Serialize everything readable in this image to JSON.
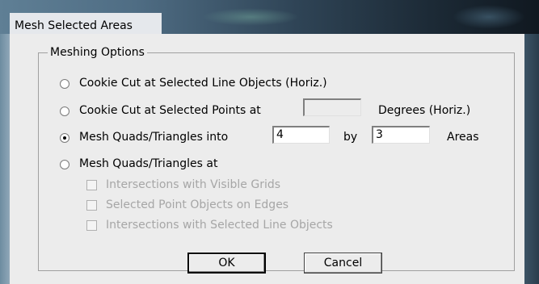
{
  "window": {
    "title": "Mesh Selected Areas"
  },
  "group": {
    "label": "Meshing Options"
  },
  "options": {
    "cookie_line": "Cookie Cut at Selected Line Objects (Horiz.)",
    "cookie_points": "Cookie Cut at Selected Points at",
    "cookie_points_suffix": "Degrees (Horiz.)",
    "cookie_points_value": "",
    "mesh_into": "Mesh Quads/Triangles into",
    "mesh_into_x": "4",
    "mesh_into_by": "by",
    "mesh_into_y": "3",
    "mesh_into_suffix": "Areas",
    "mesh_at": "Mesh Quads/Triangles at",
    "selected": "mesh_into"
  },
  "sub_options": {
    "visible_grids": "Intersections with Visible Grids",
    "point_edges": "Selected Point Objects on Edges",
    "line_objects": "Intersections with Selected Line Objects"
  },
  "buttons": {
    "ok": "OK",
    "cancel": "Cancel"
  }
}
